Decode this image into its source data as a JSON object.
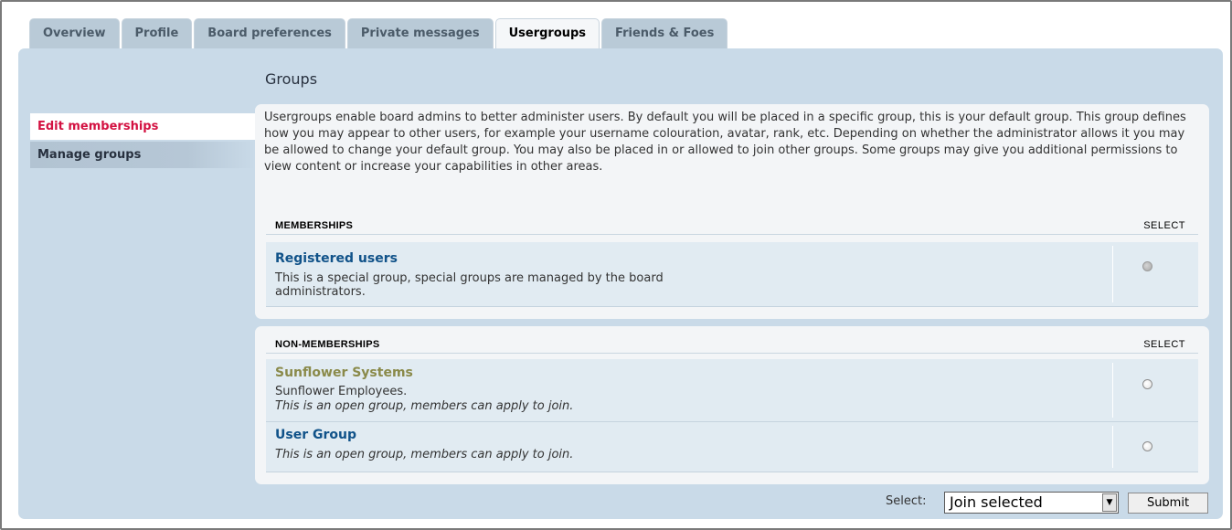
{
  "tabs": [
    {
      "label": "Overview"
    },
    {
      "label": "Profile"
    },
    {
      "label": "Board preferences"
    },
    {
      "label": "Private messages"
    },
    {
      "label": "Usergroups",
      "active": true
    },
    {
      "label": "Friends & Foes"
    }
  ],
  "sidebar": {
    "items": [
      {
        "label": "Edit memberships",
        "active": true
      },
      {
        "label": "Manage groups"
      }
    ]
  },
  "page_title": "Groups",
  "intro": "Usergroups enable board admins to better administer users. By default you will be placed in a specific group, this is your default group. This group defines how you may appear to other users, for example your username colouration, avatar, rank, etc. Depending on whether the administrator allows it you may be allowed to change your default group. You may also be placed in or allowed to join other groups. Some groups may give you additional permissions to view content or increase your capabilities in other areas.",
  "memberships": {
    "header": "MEMBERSHIPS",
    "select_label": "SELECT",
    "rows": [
      {
        "name": "Registered users",
        "description": "This is a special group, special groups are managed by the board administrators.",
        "selectable": false
      }
    ]
  },
  "non_memberships": {
    "header": "NON-MEMBERSHIPS",
    "select_label": "SELECT",
    "rows": [
      {
        "name": "Sunflower Systems",
        "description": "Sunflower Employees.",
        "note": "This is an open group, members can apply to join.",
        "selectable": true
      },
      {
        "name": "User Group",
        "note": "This is an open group, members can apply to join.",
        "selectable": true
      }
    ]
  },
  "footer": {
    "select_label": "Select:",
    "select_value": "Join selected",
    "submit_label": "Submit"
  },
  "colors": {
    "panel_bg": "#c9dae8",
    "active_menu_text": "#d31141",
    "group_link": "#105289",
    "group_special": "#8a8a4a"
  },
  "icons": {
    "select_arrow": "dropdown-arrow-icon"
  }
}
